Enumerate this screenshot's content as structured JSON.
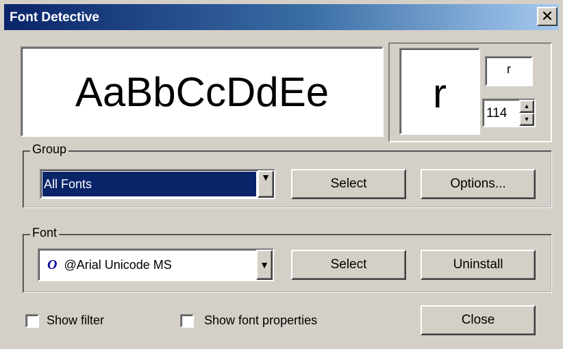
{
  "window": {
    "title": "Font Detective",
    "close_glyph": "✕"
  },
  "preview": {
    "sample_text": "AaBbCcDdEe"
  },
  "char_panel": {
    "char_preview": "r",
    "char_field": "r",
    "char_code": "114"
  },
  "group": {
    "label": "Group",
    "combo_value": "All Fonts",
    "select_label": "Select",
    "options_label": "Options..."
  },
  "font": {
    "label": "Font",
    "font_type_icon": "opentype-font-icon",
    "font_type_glyph": "O",
    "combo_value": "@Arial Unicode MS",
    "select_label": "Select",
    "uninstall_label": "Uninstall"
  },
  "footer": {
    "show_filter_label": "Show filter",
    "show_filter_checked": false,
    "show_font_properties_label": "Show font properties",
    "show_font_properties_checked": false,
    "close_label": "Close"
  },
  "colors": {
    "selection_bg": "#0a246a",
    "titlebar_start": "#0a246a",
    "titlebar_end": "#a6caf0",
    "face": "#d4d0c8"
  }
}
